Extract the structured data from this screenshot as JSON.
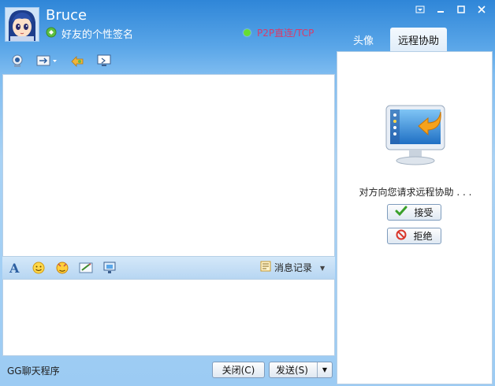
{
  "header": {
    "username": "Bruce",
    "signature": "好友的个性签名",
    "connection": "P2P直连/TCP"
  },
  "toolbar_mid": {
    "history_label": "消息记录"
  },
  "footer": {
    "status_text": "GG聊天程序",
    "close_label": "关闭(C)",
    "send_label": "发送(S)"
  },
  "tabs": [
    {
      "label": "头像"
    },
    {
      "label": "远程协助"
    }
  ],
  "remote": {
    "request_text": "对方向您请求远程协助 . . .",
    "accept_label": "接受",
    "reject_label": "拒绝"
  },
  "colors": {
    "titlebar": "#2f86d8",
    "connection_text": "#d93b6a",
    "online_dot": "#66dd33"
  }
}
